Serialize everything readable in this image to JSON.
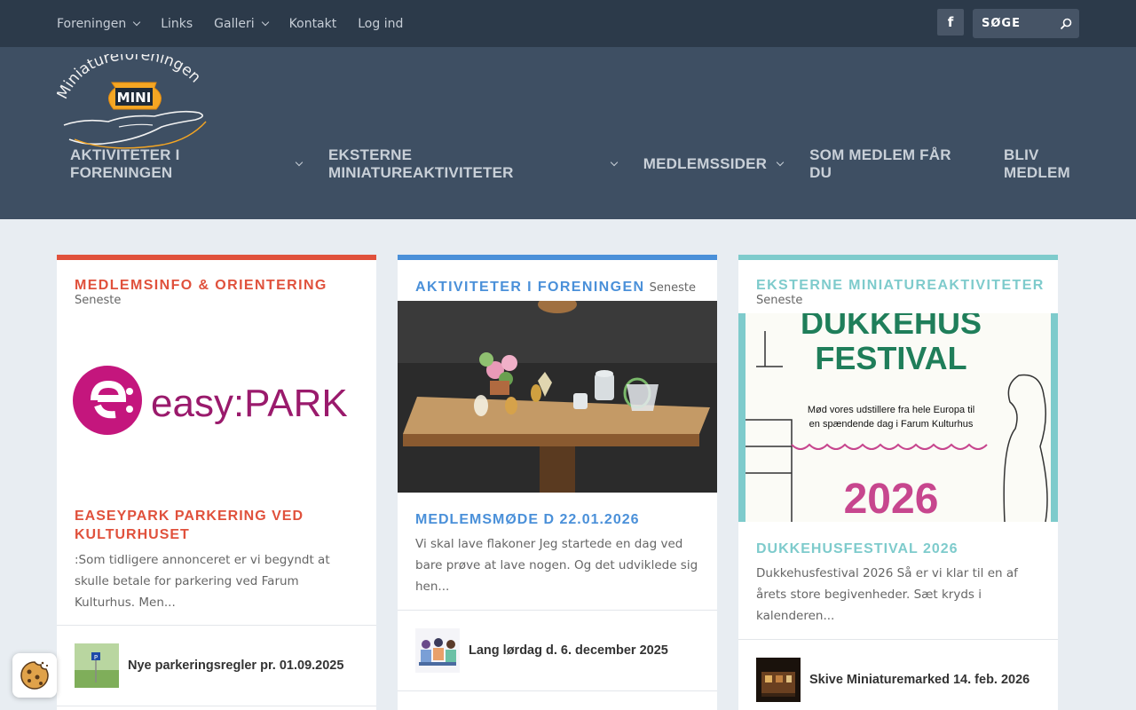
{
  "topnav": {
    "items": [
      {
        "label": "Foreningen",
        "dropdown": true
      },
      {
        "label": "Links",
        "dropdown": false
      },
      {
        "label": "Galleri",
        "dropdown": true
      },
      {
        "label": "Kontakt",
        "dropdown": false
      },
      {
        "label": "Log ind",
        "dropdown": false
      }
    ],
    "facebook_icon": "facebook-icon",
    "search_placeholder": "SØGE",
    "search_icon": "search-icon"
  },
  "logo": {
    "text_arc": "Miniatureforeningen",
    "badge": "MINI"
  },
  "mainnav": {
    "items": [
      {
        "label": "AKTIVITETER I FORENINGEN",
        "dropdown": true
      },
      {
        "label": "EKSTERNE MINIATUREAKTIVITETER",
        "dropdown": true
      },
      {
        "label": "MEDLEMSSIDER",
        "dropdown": true
      },
      {
        "label": "SOM MEDLEM FÅR DU",
        "dropdown": false
      },
      {
        "label": "BLIV MEDLEM",
        "dropdown": false
      }
    ]
  },
  "colors": {
    "topbar": "#2c3a4a",
    "header": "#3e4f63",
    "red": "#e0513c",
    "blue": "#4a90d9",
    "teal": "#7ecbcc"
  },
  "columns": [
    {
      "category": "MEDLEMSINFO & ORIENTERING",
      "subtitle": "Seneste",
      "image_logo": "easy:PARK",
      "post_title": "EASEYPARK PARKERING VED KULTURHUSET",
      "excerpt": ":Som tidligere annonceret er vi begyndt at skulle betale for parkering ved Farum Kulturhus. Men...",
      "small_post": "Nye parkeringsregler pr. 01.09.2025"
    },
    {
      "category": "AKTIVITETER I FORENINGEN",
      "subtitle": "Seneste",
      "post_title": "MEDLEMSMØDE D 22.01.2026",
      "excerpt": "Vi skal lave flakoner Jeg startede en dag ved bare prøve at lave nogen. Og det udviklede sig hen...",
      "small_post": "Lang lørdag d. 6. december 2025"
    },
    {
      "category": "EKSTERNE MINIATUREAKTIVITETER",
      "subtitle": "Seneste",
      "poster": {
        "line1": "DUKKEHUS",
        "line2": "FESTIVAL",
        "text1": "Mød vores udstillere fra hele Europa til",
        "text2": "en spændende dag i Farum Kulturhus",
        "year": "2026"
      },
      "post_title": "DUKKEHUSFESTIVAL 2026",
      "excerpt": "Dukkehusfestival 2026 Så  er vi klar til en af årets store begivenheder. Sæt kryds i kalenderen...",
      "small_post": "Skive Miniaturemarked 14. feb. 2026"
    }
  ],
  "cookie_icon": "cookie-icon"
}
